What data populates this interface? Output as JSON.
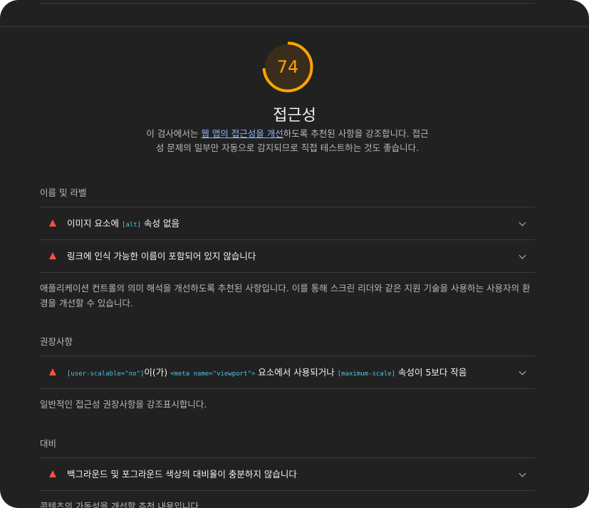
{
  "score": {
    "value": "74",
    "fraction": 0.74,
    "color": "#ffa400"
  },
  "category": {
    "title": "접근성",
    "desc_prefix": "이 검사에서는 ",
    "desc_link": "웹 앱의 접근성을 개선",
    "desc_suffix": "하도록 추천된 사항을 강조합니다. 접근성 문제의 일부만 자동으로 감지되므로 직접 테스트하는 것도 좋습니다."
  },
  "groups": [
    {
      "title": "이름 및 라벨",
      "audits": [
        {
          "pre": "이미지 요소에 ",
          "code": "[alt]",
          "post": " 속성 없음"
        },
        {
          "pre": "링크에 인식 가능한 이름이 포함되어 있지 않습니다"
        }
      ],
      "description": "애플리케이션 컨트롤의 의미 해석을 개선하도록 추천된 사항입니다. 이를 통해 스크린 리더와 같은 지원 기술을 사용하는 사용자의 환경을 개선할 수 있습니다."
    },
    {
      "title": "권장사항",
      "audits": [
        {
          "code1": "[user-scalable=\"no\"]",
          "text1": "이(가) ",
          "code2": "<meta name=\"viewport\">",
          "text2": " 요소에서 사용되거나 ",
          "code3": "[maximum-scale]",
          "text3": " 속성이 5보다 작음"
        }
      ],
      "description": "일반적인 접근성 권장사항을 강조표시합니다."
    },
    {
      "title": "대비",
      "audits": [
        {
          "pre": "백그라운드 및 포그라운드 색상의 대비율이 충분하지 않습니다"
        }
      ],
      "description": "콘텐츠의 가독성을 개선할 추천 내용입니다."
    }
  ],
  "icons": {
    "fail": "fail-triangle-icon",
    "expand": "chevron-down-icon"
  },
  "colors": {
    "background": "#212121",
    "fail": "#ff4e42",
    "average": "#ffa400",
    "link": "#8ab4f8",
    "code": "#4dc8e0"
  }
}
